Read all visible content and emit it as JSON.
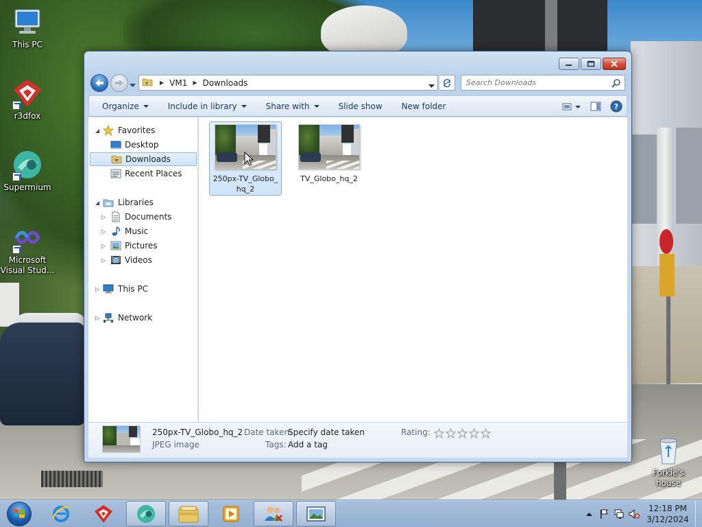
{
  "desktop": {
    "icons": [
      {
        "label": "This PC"
      },
      {
        "label": "r3dfox"
      },
      {
        "label": "Supermium"
      },
      {
        "label": "Microsoft Visual Stud..."
      },
      {
        "label": "Forkie's house"
      }
    ]
  },
  "window": {
    "address": {
      "crumbs": [
        "VM1",
        "Downloads"
      ]
    },
    "search": {
      "placeholder": "Search Downloads"
    },
    "commandbar": {
      "organize": "Organize",
      "include_in_library": "Include in library",
      "share_with": "Share with",
      "slide_show": "Slide show",
      "new_folder": "New folder"
    },
    "navpane": {
      "favorites": "Favorites",
      "desktop": "Desktop",
      "downloads": "Downloads",
      "recent_places": "Recent Places",
      "libraries": "Libraries",
      "documents": "Documents",
      "music": "Music",
      "pictures": "Pictures",
      "videos": "Videos",
      "this_pc": "This PC",
      "network": "Network"
    },
    "files": [
      {
        "name": "250px-TV_Globo_hq_2"
      },
      {
        "name": "TV_Globo_hq_2"
      }
    ],
    "details": {
      "name": "250px-TV_Globo_hq_2",
      "type": "JPEG image",
      "date_label": "Date taken:",
      "date_value": "Specify date taken",
      "tags_label": "Tags:",
      "tags_value": "Add a tag",
      "rating_label": "Rating:",
      "rating_stars": 0,
      "rating_max": 5
    }
  },
  "taskbar": {
    "clock": {
      "time": "12:18 PM",
      "date": "3/12/2024"
    }
  },
  "colors": {
    "accent": "#1e395b",
    "selection": "#cde4f8",
    "selection_border": "#84acdd",
    "r3dfox_red": "#d3302b",
    "supermium_teal": "#3fb6a3"
  }
}
